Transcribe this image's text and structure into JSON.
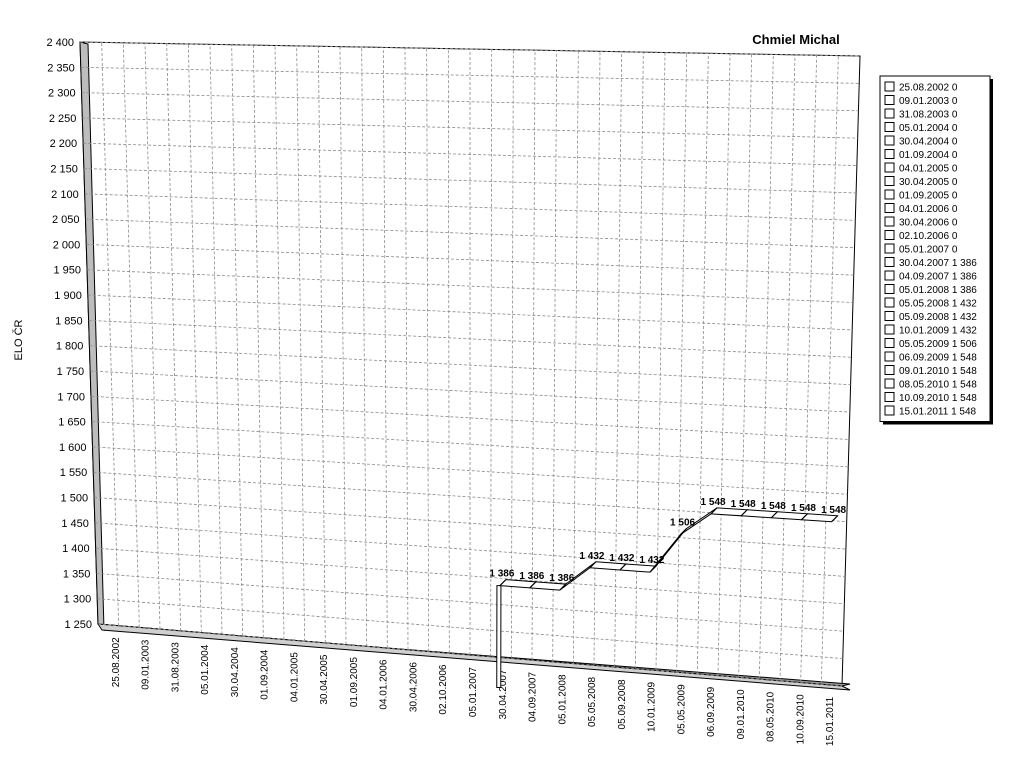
{
  "chart_data": {
    "type": "line",
    "title": "Chmiel Michal",
    "ylabel": "ELO ČR",
    "xlabel": "",
    "ylim": [
      1250,
      2400
    ],
    "y_ticks": [
      1250,
      1300,
      1350,
      1400,
      1450,
      1500,
      1550,
      1600,
      1650,
      1700,
      1750,
      1800,
      1850,
      1900,
      1950,
      2000,
      2050,
      2100,
      2150,
      2200,
      2250,
      2300,
      2350,
      2400
    ],
    "y_tick_labels": [
      "1 250",
      "1 300",
      "1 350",
      "1 400",
      "1 450",
      "1 500",
      "1 550",
      "1 600",
      "1 650",
      "1 700",
      "1 750",
      "1 800",
      "1 850",
      "1 900",
      "1 950",
      "2 000",
      "2 050",
      "2 100",
      "2 150",
      "2 200",
      "2 250",
      "2 300",
      "2 350",
      "2 400"
    ],
    "categories": [
      "25.08.2002",
      "09.01.2003",
      "31.08.2003",
      "05.01.2004",
      "30.04.2004",
      "01.09.2004",
      "04.01.2005",
      "30.04.2005",
      "01.09.2005",
      "04.01.2006",
      "30.04.2006",
      "02.10.2006",
      "05.01.2007",
      "30.04.2007",
      "04.09.2007",
      "05.01.2008",
      "05.05.2008",
      "05.09.2008",
      "10.01.2009",
      "05.05.2009",
      "06.09.2009",
      "09.01.2010",
      "08.05.2010",
      "10.09.2010",
      "15.01.2011"
    ],
    "values": [
      0,
      0,
      0,
      0,
      0,
      0,
      0,
      0,
      0,
      0,
      0,
      0,
      0,
      1386,
      1386,
      1386,
      1432,
      1432,
      1432,
      1506,
      1548,
      1548,
      1548,
      1548,
      1548
    ],
    "data_labels": [
      "",
      "",
      "",
      "",
      "",
      "",
      "",
      "",
      "",
      "",
      "",
      "",
      "",
      "1 386",
      "1 386",
      "1 386",
      "1 432",
      "1 432",
      "1 432",
      "1 506",
      "1 548",
      "1 548",
      "1 548",
      "1 548",
      "1 548"
    ],
    "grid": true,
    "legend_position": "right",
    "legend_entries": [
      "25.08.2002 0",
      "09.01.2003 0",
      "31.08.2003 0",
      "05.01.2004 0",
      "30.04.2004 0",
      "01.09.2004 0",
      "04.01.2005 0",
      "30.04.2005 0",
      "01.09.2005 0",
      "04.01.2006 0",
      "30.04.2006 0",
      "02.10.2006 0",
      "05.01.2007 0",
      "30.04.2007 1 386",
      "04.09.2007 1 386",
      "05.01.2008 1 386",
      "05.05.2008 1 432",
      "05.09.2008 1 432",
      "10.01.2009 1 432",
      "05.05.2009 1 506",
      "06.09.2009 1 548",
      "09.01.2010 1 548",
      "08.05.2010 1 548",
      "10.09.2010 1 548",
      "15.01.2011 1 548"
    ]
  }
}
